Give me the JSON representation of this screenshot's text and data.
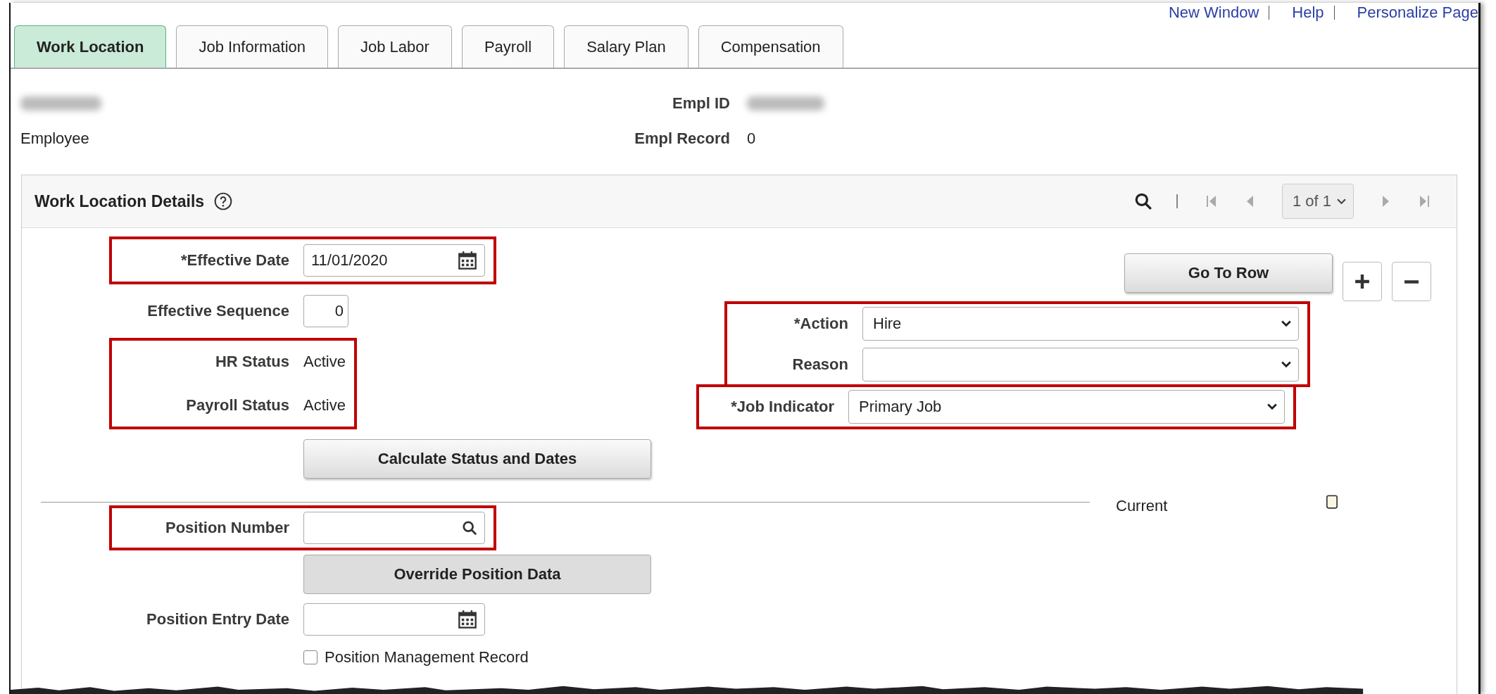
{
  "header_links": [
    {
      "label": "New Window"
    },
    {
      "label": "Help"
    },
    {
      "label": "Personalize Page"
    }
  ],
  "tabs": [
    {
      "label": "Work Location",
      "selected": true
    },
    {
      "label": "Job Information",
      "selected": false
    },
    {
      "label": "Job Labor",
      "selected": false
    },
    {
      "label": "Payroll",
      "selected": false
    },
    {
      "label": "Salary Plan",
      "selected": false
    },
    {
      "label": "Compensation",
      "selected": false
    }
  ],
  "employee": {
    "role": "Employee",
    "empl_id_label": "Empl ID",
    "empl_record_label": "Empl Record",
    "empl_record": "0"
  },
  "panel": {
    "title": "Work Location Details",
    "pager": {
      "position": "1 of 1"
    }
  },
  "left_groups": [
    {
      "highlighted": true,
      "rows": [
        {
          "kind": "date",
          "label": "*Effective Date",
          "value": "11/01/2020"
        }
      ]
    },
    {
      "highlighted": false,
      "rows": [
        {
          "kind": "number",
          "label": "Effective Sequence",
          "value": "0"
        }
      ]
    },
    {
      "highlighted": true,
      "rows": [
        {
          "kind": "text",
          "label": "HR Status",
          "value": "Active"
        },
        {
          "kind": "text",
          "label": "Payroll Status",
          "value": "Active"
        }
      ]
    },
    {
      "highlighted": false,
      "rows": [
        {
          "kind": "button",
          "label": "Calculate Status and Dates"
        }
      ]
    }
  ],
  "right_button": {
    "label": "Go To Row"
  },
  "right_groups": [
    {
      "highlighted": true,
      "rows": [
        {
          "kind": "select",
          "label": "*Action",
          "value": "Hire"
        },
        {
          "kind": "select",
          "label": "Reason"
        }
      ]
    },
    {
      "highlighted": true,
      "rows": [
        {
          "kind": "select",
          "label": "*Job Indicator",
          "value": "Primary Job"
        }
      ]
    }
  ],
  "current": {
    "label": "Current"
  },
  "lower_groups": [
    {
      "highlighted": true,
      "rows": [
        {
          "kind": "lookup",
          "label": "Position Number"
        }
      ]
    },
    {
      "highlighted": false,
      "rows": [
        {
          "kind": "button",
          "label": "Override Position Data"
        }
      ]
    },
    {
      "highlighted": false,
      "rows": [
        {
          "kind": "date",
          "label": "Position Entry Date"
        }
      ]
    },
    {
      "highlighted": false,
      "rows": [
        {
          "kind": "checkbox",
          "label": "Position Management Record",
          "checked": false
        }
      ]
    }
  ]
}
